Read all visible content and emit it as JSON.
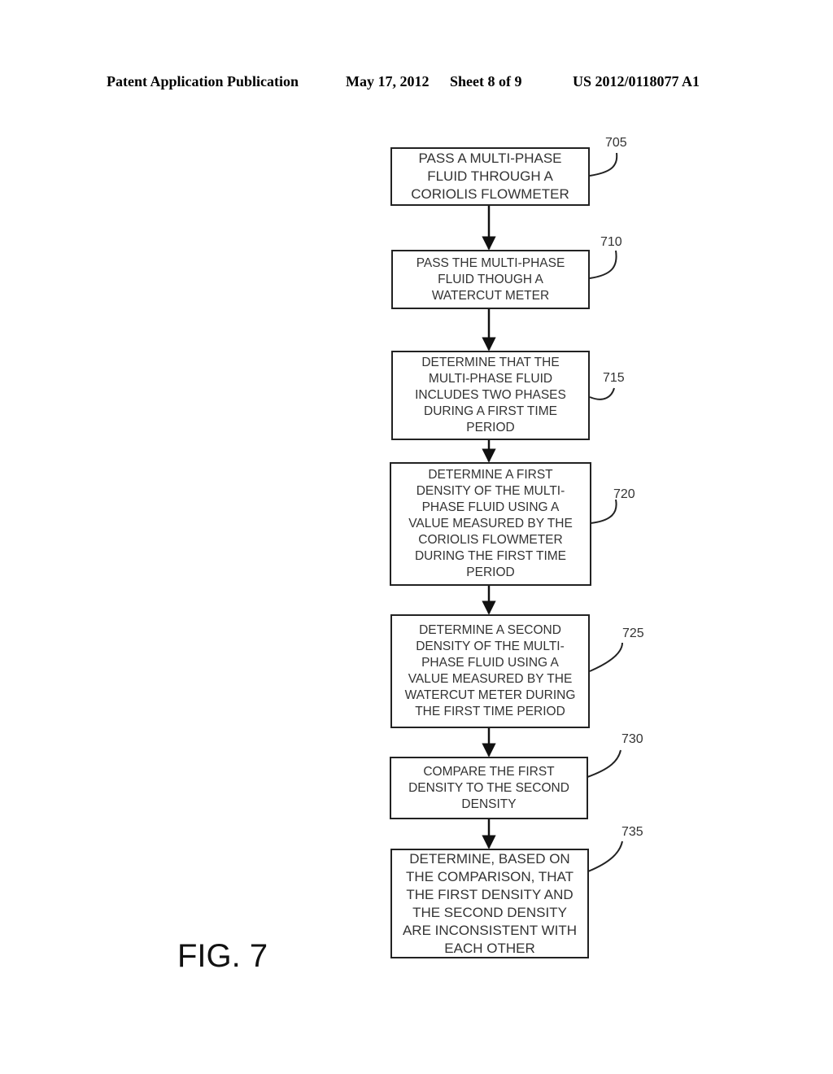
{
  "header": {
    "publication": "Patent Application Publication",
    "date": "May 17, 2012",
    "sheet": "Sheet 8 of 9",
    "number": "US 2012/0118077 A1"
  },
  "figure_label": "FIG. 7",
  "steps": [
    {
      "ref": "705",
      "lines": [
        "PASS A MULTI-PHASE",
        "FLUID THROUGH A",
        "CORIOLIS FLOWMETER"
      ]
    },
    {
      "ref": "710",
      "lines": [
        "PASS THE MULTI-PHASE",
        "FLUID THOUGH A",
        "WATERCUT METER"
      ]
    },
    {
      "ref": "715",
      "lines": [
        "DETERMINE THAT THE",
        "MULTI-PHASE FLUID",
        "INCLUDES TWO PHASES",
        "DURING A FIRST TIME",
        "PERIOD"
      ]
    },
    {
      "ref": "720",
      "lines": [
        "DETERMINE A FIRST",
        "DENSITY OF THE MULTI-",
        "PHASE FLUID USING A",
        "VALUE MEASURED BY THE",
        "CORIOLIS FLOWMETER",
        "DURING THE FIRST TIME",
        "PERIOD"
      ]
    },
    {
      "ref": "725",
      "lines": [
        "DETERMINE A SECOND",
        "DENSITY OF THE MULTI-",
        "PHASE FLUID USING A",
        "VALUE MEASURED BY THE",
        "WATERCUT METER DURING",
        "THE FIRST TIME PERIOD"
      ]
    },
    {
      "ref": "730",
      "lines": [
        "COMPARE THE FIRST",
        "DENSITY TO THE SECOND",
        "DENSITY"
      ]
    },
    {
      "ref": "735",
      "lines": [
        "DETERMINE, BASED ON",
        "THE COMPARISON, THAT",
        "THE FIRST DENSITY AND",
        "THE SECOND DENSITY",
        "ARE INCONSISTENT WITH",
        "EACH OTHER"
      ]
    }
  ]
}
